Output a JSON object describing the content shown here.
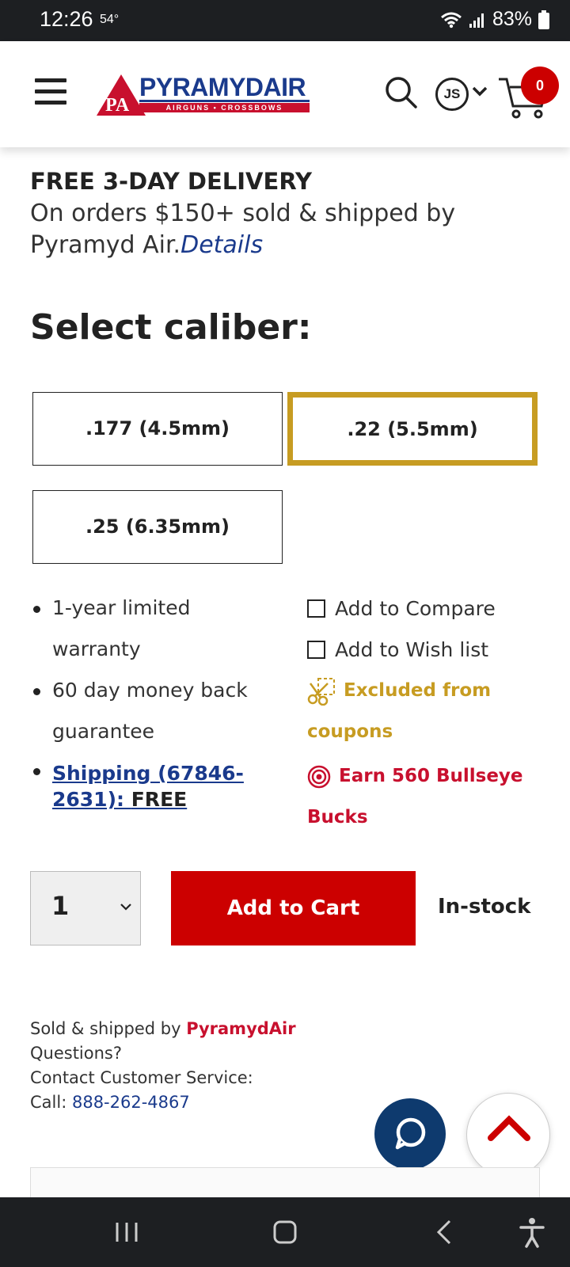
{
  "status_bar": {
    "time": "12:26",
    "temp": "54°",
    "battery": "83%"
  },
  "header": {
    "logo_monogram": "PA",
    "logo_name": "PYRAMYDAIR",
    "logo_tagline": "AIRGUNS • CROSSBOWS",
    "account_initials": "JS",
    "cart_count": "0"
  },
  "delivery": {
    "title": "FREE 3-DAY DELIVERY",
    "text": "On orders $150+ sold & shipped by Pyramyd Air.",
    "link": "Details"
  },
  "caliber": {
    "title": "Select caliber:",
    "options": [
      {
        "label": ".177 (4.5mm)",
        "selected": false
      },
      {
        "label": ".22 (5.5mm)",
        "selected": true
      },
      {
        "label": ".25 (6.35mm)",
        "selected": false
      }
    ]
  },
  "features": {
    "items": [
      "1-year limited warranty",
      "60 day money back guarantee"
    ],
    "shipping_link": "Shipping (67846-2631):",
    "shipping_value": "FREE"
  },
  "actions": {
    "compare": "Add to Compare",
    "wishlist": "Add to Wish list",
    "excluded": "Excluded from coupons",
    "bullseye": "Earn 560 Bullseye Bucks"
  },
  "purchase": {
    "quantity": "1",
    "add_to_cart": "Add to Cart",
    "stock": "In-stock"
  },
  "seller": {
    "sold_prefix": "Sold & shipped by",
    "sold_brand": "PyramydAir",
    "questions": "Questions?",
    "contact": "Contact Customer Service:",
    "call_prefix": "Call:",
    "phone": "888-262-4867"
  },
  "colors": {
    "brand_red": "#cc0000",
    "brand_blue": "#1a3a8c",
    "gold": "#c79c22"
  }
}
